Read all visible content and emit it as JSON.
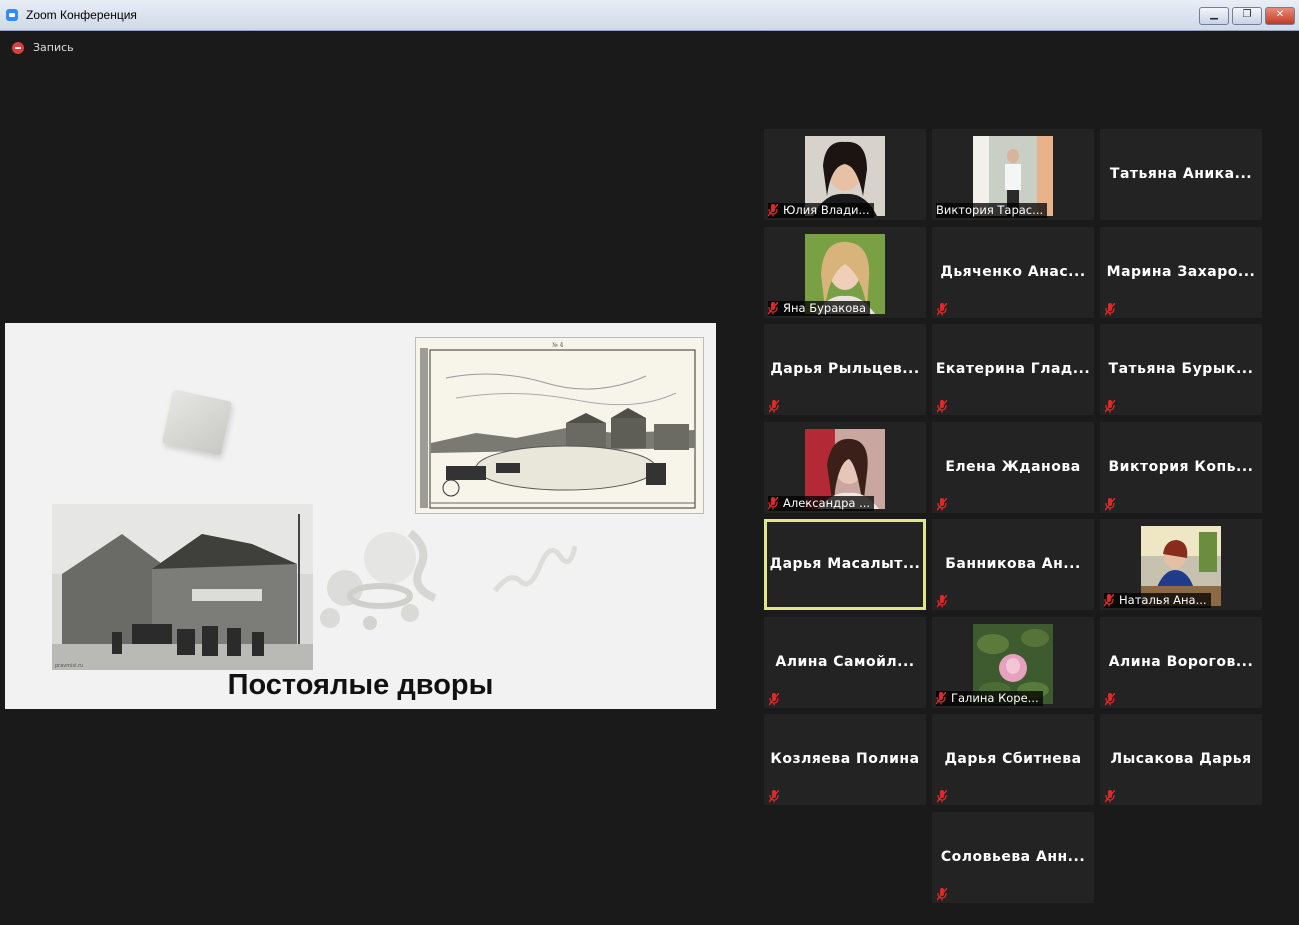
{
  "window": {
    "title": "Zoom Конференция"
  },
  "recording": {
    "label": "Запись"
  },
  "slide": {
    "title": "Постоялые дворы",
    "top_caption": "№ 4",
    "bottom_caption": "pravmisl.ru"
  },
  "participants": [
    {
      "name": "Юлия Влади...",
      "video": true,
      "muted": true,
      "active": false
    },
    {
      "name": "Виктория Тарас...",
      "video": true,
      "muted": false,
      "active": false
    },
    {
      "name": "Татьяна  Аника...",
      "video": false,
      "muted": false,
      "active": false
    },
    {
      "name": "Яна Буракова",
      "video": true,
      "muted": true,
      "active": false
    },
    {
      "name": "Дьяченко  Анас...",
      "video": false,
      "muted": true,
      "active": false
    },
    {
      "name": "Марина  Захаро...",
      "video": false,
      "muted": true,
      "active": false
    },
    {
      "name": "Дарья  Рыльцев...",
      "video": false,
      "muted": true,
      "active": false
    },
    {
      "name": "Екатерина  Глад...",
      "video": false,
      "muted": true,
      "active": false
    },
    {
      "name": "Татьяна  Бурык...",
      "video": false,
      "muted": true,
      "active": false
    },
    {
      "name": "Александра ...",
      "video": true,
      "muted": true,
      "active": false
    },
    {
      "name": "Елена Жданова",
      "video": false,
      "muted": true,
      "active": false
    },
    {
      "name": "Виктория  Копь...",
      "video": false,
      "muted": true,
      "active": false
    },
    {
      "name": "Дарья  Масалыт...",
      "video": false,
      "muted": false,
      "active": true
    },
    {
      "name": "Банникова  Ан...",
      "video": false,
      "muted": true,
      "active": false
    },
    {
      "name": "Наталья Ана...",
      "video": true,
      "muted": true,
      "active": false
    },
    {
      "name": "Алина  Самойл...",
      "video": false,
      "muted": true,
      "active": false
    },
    {
      "name": "Галина Коре...",
      "video": true,
      "muted": true,
      "active": false
    },
    {
      "name": "Алина  Ворогов...",
      "video": false,
      "muted": true,
      "active": false
    },
    {
      "name": "Козляева Полина",
      "video": false,
      "muted": true,
      "active": false
    },
    {
      "name": "Дарья Сбитнева",
      "video": false,
      "muted": true,
      "active": false
    },
    {
      "name": "Лысакова Дарья",
      "video": false,
      "muted": true,
      "active": false
    },
    {
      "name": "Соловьева  Анн...",
      "video": false,
      "muted": true,
      "active": false
    }
  ]
}
